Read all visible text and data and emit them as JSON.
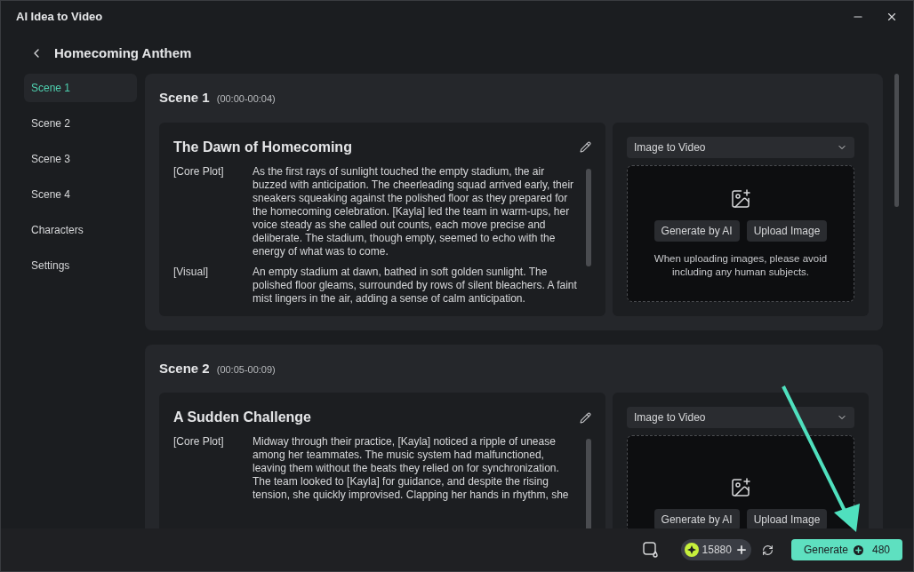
{
  "window": {
    "title": "AI Idea to Video"
  },
  "header": {
    "title": "Homecoming Anthem"
  },
  "sidebar": {
    "items": [
      {
        "label": "Scene 1",
        "selected": true
      },
      {
        "label": "Scene 2",
        "selected": false
      },
      {
        "label": "Scene 3",
        "selected": false
      },
      {
        "label": "Scene 4",
        "selected": false
      },
      {
        "label": "Characters",
        "selected": false
      },
      {
        "label": "Settings",
        "selected": false
      }
    ]
  },
  "scenes": [
    {
      "title": "Scene 1",
      "time": "(00:00-00:04)",
      "card": {
        "heading": "The Dawn of Homecoming",
        "fields": [
          {
            "label": "[Core Plot]",
            "text": "As the first rays of sunlight touched the empty stadium, the air buzzed with anticipation. The cheerleading squad arrived early, their sneakers squeaking against the polished floor as they prepared for the homecoming celebration. [Kayla] led the team in warm-ups, her voice steady as she called out counts, each move precise and deliberate. The stadium, though empty, seemed to echo with the energy of what was to come."
          },
          {
            "label": "[Visual]",
            "text": "An empty stadium at dawn, bathed in soft golden sunlight. The polished floor gleams, surrounded by rows of silent bleachers. A faint mist lingers in the air, adding a sense of calm anticipation."
          }
        ]
      },
      "media": {
        "mode": "Image to Video",
        "buttons": [
          "Generate by AI",
          "Upload Image"
        ],
        "note": "When uploading images, please avoid including any human subjects."
      }
    },
    {
      "title": "Scene 2",
      "time": "(00:05-00:09)",
      "card": {
        "heading": "A Sudden Challenge",
        "fields": [
          {
            "label": "[Core Plot]",
            "text": "Midway through their practice, [Kayla] noticed a ripple of unease among her teammates. The music system had malfunctioned, leaving them without the beats they relied on for synchronization. The team looked to [Kayla] for guidance, and despite the rising tension, she quickly improvised. Clapping her hands in rhythm, she"
          }
        ]
      },
      "media": {
        "mode": "Image to Video",
        "buttons": [
          "Generate by AI",
          "Upload Image"
        ]
      }
    }
  ],
  "footer": {
    "credits": "15880",
    "generate": {
      "label": "Generate",
      "cost": "480"
    }
  }
}
